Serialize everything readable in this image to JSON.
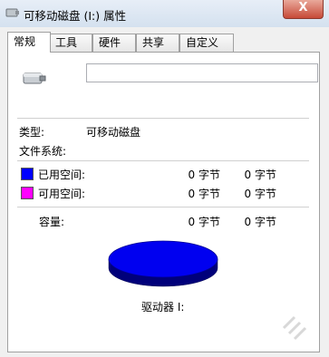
{
  "window": {
    "title": "可移动磁盘 (I:) 属性",
    "close_glyph": "X"
  },
  "tabs": [
    {
      "label": "常规",
      "active": true
    },
    {
      "label": "工具",
      "active": false
    },
    {
      "label": "硬件",
      "active": false
    },
    {
      "label": "共享",
      "active": false
    },
    {
      "label": "自定义",
      "active": false
    }
  ],
  "general": {
    "name_value": "",
    "type_label": "类型:",
    "type_value": "可移动磁盘",
    "filesystem_label": "文件系统:",
    "filesystem_value": "",
    "used_label": "已用空间:",
    "used_bytes": "0 字节",
    "used_size": "0 字节",
    "used_color": "#0000ff",
    "free_label": "可用空间:",
    "free_bytes": "0 字节",
    "free_size": "0 字节",
    "free_color": "#ff00ff",
    "capacity_label": "容量:",
    "capacity_bytes": "0 字节",
    "capacity_size": "0 字节",
    "drive_label": "驱动器 I:"
  },
  "icons": {
    "title_icon": "removable-drive-icon",
    "drive_icon": "removable-drive-icon"
  }
}
